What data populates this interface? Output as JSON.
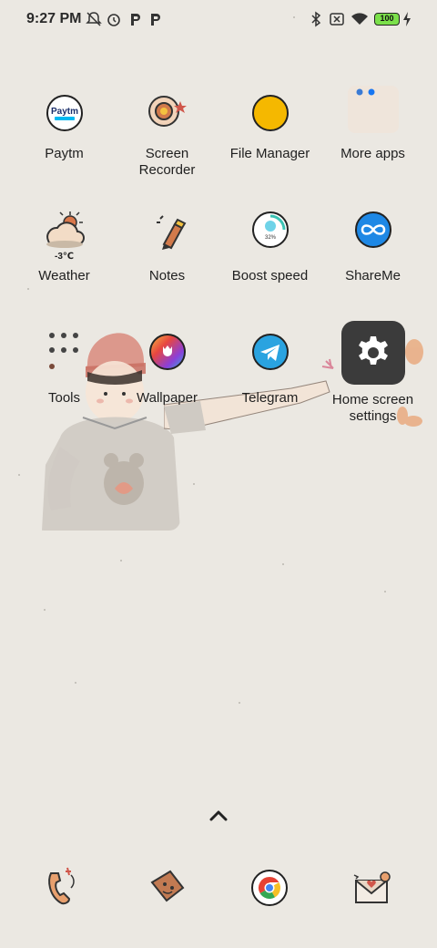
{
  "status_bar": {
    "time": "9:27 PM",
    "battery_level": "100",
    "left_icons": [
      "notifications-off-icon",
      "alarm-icon",
      "paytm-notification-icon",
      "paytm-notification-icon"
    ],
    "right_icons": [
      "bluetooth-icon",
      "sim-off-icon",
      "wifi-icon",
      "battery-icon",
      "charging-icon"
    ]
  },
  "apps": [
    {
      "label": "Paytm",
      "icon": "paytm-icon",
      "brand_text": "Paytm"
    },
    {
      "label": "Screen\nRecorder",
      "icon": "screen-recorder-icon"
    },
    {
      "label": "File Manager",
      "icon": "file-manager-icon"
    },
    {
      "label": "More apps",
      "icon": "more-apps-folder-icon"
    },
    {
      "label": "Weather",
      "icon": "weather-icon",
      "temperature": "-3℃"
    },
    {
      "label": "Notes",
      "icon": "notes-icon"
    },
    {
      "label": "Boost speed",
      "icon": "boost-speed-icon",
      "percent": "32%"
    },
    {
      "label": "ShareMe",
      "icon": "shareme-icon"
    },
    {
      "label": "Tools",
      "icon": "tools-folder-icon"
    },
    {
      "label": "Wallpaper",
      "icon": "wallpaper-icon"
    },
    {
      "label": "Telegram",
      "icon": "telegram-icon"
    },
    {
      "label": "Home screen\nsettings",
      "icon": "settings-gear-icon"
    }
  ],
  "dock": [
    "phone-icon",
    "messages-icon",
    "chrome-icon",
    "email-icon"
  ],
  "colors": {
    "background": "#ebe8e2",
    "file_manager": "#f5b800",
    "shareme": "#1e88e5",
    "telegram": "#2aa3e0",
    "settings": "#3b3b3b",
    "battery": "#7be04a"
  }
}
